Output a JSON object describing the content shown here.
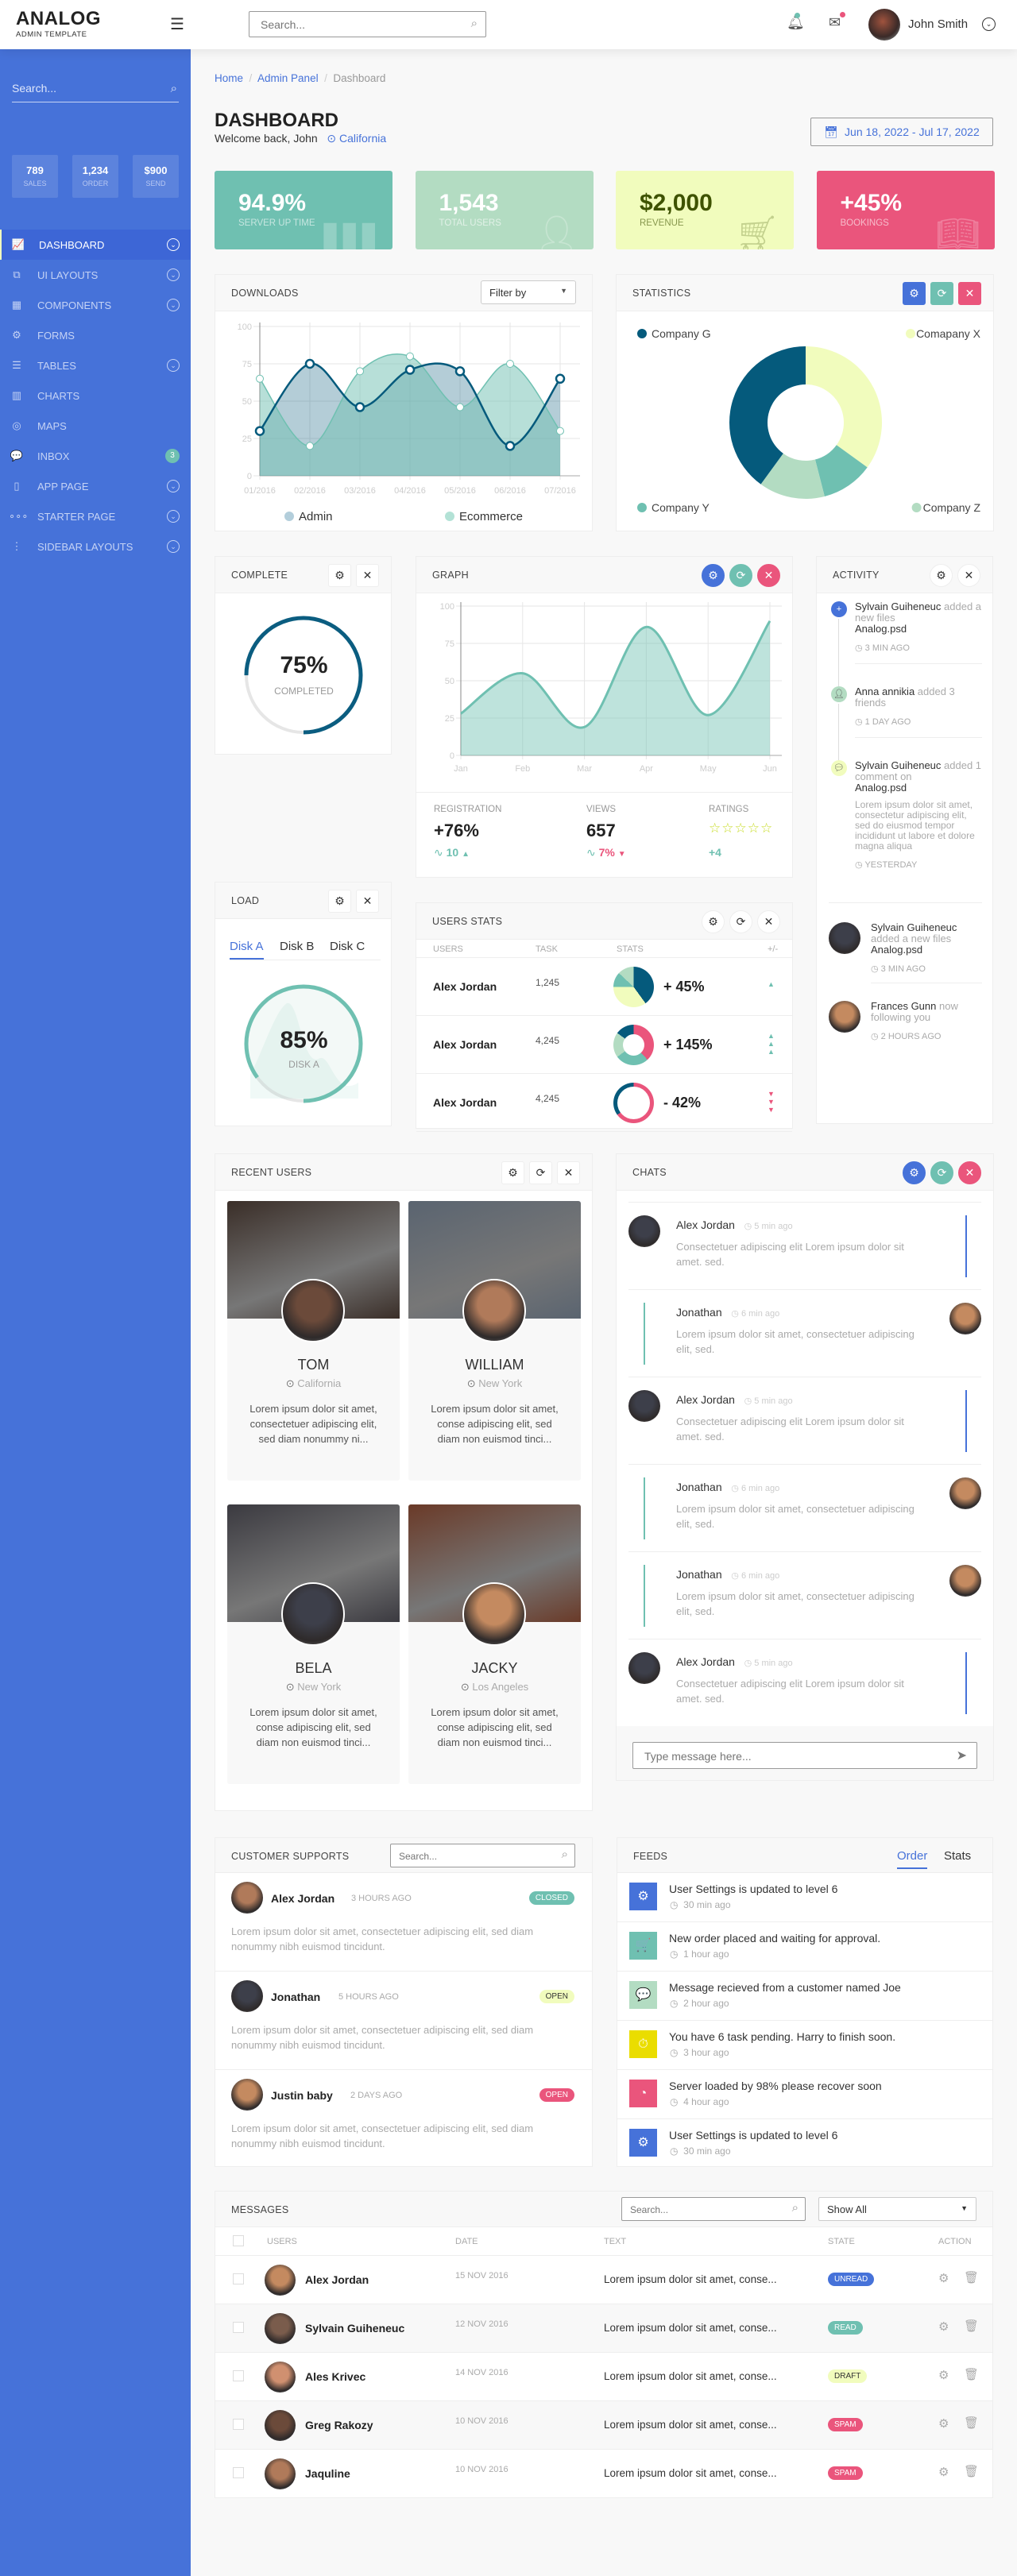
{
  "header": {
    "logo": "ANALOG",
    "logo_sub": "ADMIN TEMPLATE",
    "search_placeholder": "Search...",
    "user_name": "John Smith"
  },
  "sidebar": {
    "search_placeholder": "Search...",
    "stats": [
      {
        "value": "789",
        "label": "SALES"
      },
      {
        "value": "1,234",
        "label": "ORDER"
      },
      {
        "value": "$900",
        "label": "SEND"
      }
    ],
    "items": [
      {
        "label": "DASHBOARD",
        "icon": "chart-line-icon",
        "glyph": "📈",
        "active": true,
        "chevron": true
      },
      {
        "label": "UI LAYOUTS",
        "icon": "layers-icon",
        "glyph": "⧉",
        "chevron": true
      },
      {
        "label": "COMPONENTS",
        "icon": "grid-icon",
        "glyph": "▦",
        "chevron": true
      },
      {
        "label": "FORMS",
        "icon": "gear-icon",
        "glyph": "⚙",
        "chevron": false
      },
      {
        "label": "TABLES",
        "icon": "list-icon",
        "glyph": "☰",
        "chevron": true
      },
      {
        "label": "CHARTS",
        "icon": "bar-chart-icon",
        "glyph": "▥",
        "chevron": false
      },
      {
        "label": "MAPS",
        "icon": "map-pin-icon",
        "glyph": "◎",
        "chevron": false
      },
      {
        "label": "INBOX",
        "icon": "chat-icon",
        "glyph": "💬",
        "chevron": false,
        "badge": "3"
      },
      {
        "label": "APP PAGE",
        "icon": "book-icon",
        "glyph": "▯",
        "chevron": true
      },
      {
        "label": "STARTER PAGE",
        "icon": "dots-horizontal-icon",
        "glyph": "∘∘∘",
        "chevron": true
      },
      {
        "label": "SIDEBAR LAYOUTS",
        "icon": "dots-vertical-icon",
        "glyph": "⋮",
        "chevron": true
      }
    ]
  },
  "page": {
    "breadcrumb": [
      "Home",
      "Admin Panel",
      "Dashboard"
    ],
    "title": "DASHBOARD",
    "welcome": "Welcome back, John",
    "location": "California",
    "date_range": "Jun 18, 2022 - Jul 17, 2022"
  },
  "stat_cards": [
    {
      "value": "94.9%",
      "label": "SERVER UP TIME",
      "bg": "#6fc0b1",
      "fg": "#ffffff",
      "icon": "bar-chart-icon"
    },
    {
      "value": "1,543",
      "label": "TOTAL USERS",
      "bg": "#b3dcc2",
      "fg": "#ffffff",
      "icon": "user-icon"
    },
    {
      "value": "$2,000",
      "label": "REVENUE",
      "bg": "#f1fcbd",
      "fg": "#3e5200",
      "icon": "cart-icon"
    },
    {
      "value": "+45%",
      "label": "BOOKINGS",
      "bg": "#ea557c",
      "fg": "#ffffff",
      "icon": "book-icon"
    }
  ],
  "downloads": {
    "title": "DOWNLOADS",
    "filter": "Filter by"
  },
  "statistics": {
    "title": "STATISTICS"
  },
  "complete": {
    "title": "COMPLETE",
    "value": "75%",
    "label": "COMPLETED",
    "percent": 75
  },
  "graph": {
    "title": "GRAPH",
    "stats": [
      {
        "label": "REGISTRATION",
        "value": "+76%",
        "sub": "10",
        "trend": "up",
        "color": "#6fc0b1"
      },
      {
        "label": "VIEWS",
        "value": "657",
        "sub": "7%",
        "trend": "down",
        "color": "#ea557c"
      },
      {
        "label": "RATINGS",
        "value": "",
        "sub": "+4",
        "stars": 5,
        "color": "#6fc0b1"
      }
    ]
  },
  "activity": {
    "title": "ACTIVITY",
    "items": [
      {
        "name": "Sylvain Guiheneuc",
        "action": "added a new files",
        "file": "Analog.psd",
        "time": "3 MIN AGO",
        "icon": "plus-icon",
        "color": "#4672d9"
      },
      {
        "name": "Anna annikia",
        "action": "added 3 friends",
        "file": "",
        "time": "1 DAY AGO",
        "icon": "user-icon",
        "color": "#b3dcc2"
      },
      {
        "name": "Sylvain Guiheneuc",
        "action": "added 1 comment on",
        "file": "Analog.psd",
        "body": "Lorem ipsum dolor sit amet, consectetur adipiscing elit, sed do eiusmod tempor incididunt ut labore et dolore magna aliqua",
        "time": "YESTERDAY",
        "icon": "chat-icon",
        "color": "#f1fcbd"
      }
    ],
    "items2": [
      {
        "name": "Sylvain Guiheneuc",
        "action": "added a new files",
        "file": "Analog.psd",
        "time": "3 MIN AGO"
      },
      {
        "name": "Frances Gunn",
        "action": "now following you",
        "file": "",
        "time": "2 HOURS AGO"
      }
    ]
  },
  "load": {
    "title": "LOAD",
    "tabs": [
      "Disk A",
      "Disk B",
      "Disk C"
    ],
    "active_tab": 0,
    "value": "85%",
    "label": "DISK A",
    "percent": 85
  },
  "users_stats": {
    "title": "USERS STATS",
    "columns": [
      "USERS",
      "TASK",
      "STATS",
      "+/-"
    ],
    "rows": [
      {
        "name": "Alex Jordan",
        "task": "1,245",
        "change": "+ 45%",
        "trend": "up",
        "arrows": 1
      },
      {
        "name": "Alex Jordan",
        "task": "4,245",
        "change": "+ 145%",
        "trend": "up",
        "arrows": 3
      },
      {
        "name": "Alex Jordan",
        "task": "4,245",
        "change": "- 42%",
        "trend": "down",
        "arrows": 3
      }
    ]
  },
  "recent_users": {
    "title": "RECENT USERS",
    "users": [
      {
        "name": "TOM",
        "location": "California",
        "text": "Lorem ipsum dolor sit amet, consectetuer adipiscing elit, sed diam nonummy ni..."
      },
      {
        "name": "WILLIAM",
        "location": "New York",
        "text": "Lorem ipsum dolor sit amet, conse adipiscing elit, sed diam non euismod tinci..."
      },
      {
        "name": "BELA",
        "location": "New York",
        "text": "Lorem ipsum dolor sit amet, conse adipiscing elit, sed diam non euismod tinci..."
      },
      {
        "name": "JACKY",
        "location": "Los Angeles",
        "text": "Lorem ipsum dolor sit amet, conse adipiscing elit, sed diam non euismod tinci..."
      }
    ]
  },
  "chats": {
    "title": "CHATS",
    "input_placeholder": "Type message here...",
    "messages": [
      {
        "name": "Alex Jordan",
        "time": "5 min ago",
        "text": "Consectetuer adipiscing elit Lorem ipsum dolor sit amet. sed.",
        "side": "left"
      },
      {
        "name": "Jonathan",
        "time": "6 min ago",
        "text": "Lorem ipsum dolor sit amet, consectetuer adipiscing elit, sed.",
        "side": "right"
      },
      {
        "name": "Alex Jordan",
        "time": "5 min ago",
        "text": "Consectetuer adipiscing elit Lorem ipsum dolor sit amet. sed.",
        "side": "left"
      },
      {
        "name": "Jonathan",
        "time": "6 min ago",
        "text": "Lorem ipsum dolor sit amet, consectetuer adipiscing elit, sed.",
        "side": "right"
      },
      {
        "name": "Jonathan",
        "time": "6 min ago",
        "text": "Lorem ipsum dolor sit amet, consectetuer adipiscing elit, sed.",
        "side": "right"
      },
      {
        "name": "Alex Jordan",
        "time": "5 min ago",
        "text": "Consectetuer adipiscing elit Lorem ipsum dolor sit amet. sed.",
        "side": "left"
      }
    ]
  },
  "supports": {
    "title": "CUSTOMER SUPPORTS",
    "search_placeholder": "Search...",
    "items": [
      {
        "name": "Alex Jordan",
        "time": "3 HOURS AGO",
        "status": "CLOSED",
        "status_bg": "#6fc0b1",
        "status_fg": "#ffffff",
        "text": "Lorem ipsum dolor sit amet, consectetuer adipiscing elit, sed diam nonummy nibh euismod tincidunt."
      },
      {
        "name": "Jonathan",
        "time": "5 HOURS AGO",
        "status": "OPEN",
        "status_bg": "#f1fcbd",
        "status_fg": "#333333",
        "text": "Lorem ipsum dolor sit amet, consectetuer adipiscing elit, sed diam nonummy nibh euismod tincidunt."
      },
      {
        "name": "Justin baby",
        "time": "2 DAYS AGO",
        "status": "OPEN",
        "status_bg": "#ea557c",
        "status_fg": "#ffffff",
        "text": "Lorem ipsum dolor sit amet, consectetuer adipiscing elit, sed diam nonummy nibh euismod tincidunt."
      }
    ]
  },
  "feeds": {
    "title": "FEEDS",
    "tabs": [
      "Order",
      "Stats"
    ],
    "active_tab": 0,
    "items": [
      {
        "text": "User Settings is updated to level 6",
        "time": "30 min ago",
        "icon": "gear-icon",
        "glyph": "⚙",
        "color": "#4672d9"
      },
      {
        "text": "New order placed and waiting for approval.",
        "time": "1 hour ago",
        "icon": "cart-icon",
        "glyph": "🛒",
        "color": "#6fc0b1"
      },
      {
        "text": "Message recieved from a customer named Joe",
        "time": "2 hour ago",
        "icon": "chat-icon",
        "glyph": "💬",
        "color": "#b3dcc2"
      },
      {
        "text": "You have 6 task pending. Harry to finish soon.",
        "time": "3 hour ago",
        "icon": "timer-icon",
        "glyph": "⏱",
        "color": "#eadd00"
      },
      {
        "text": "Server loaded by 98% please recover soon",
        "time": "4 hour ago",
        "icon": "gauge-icon",
        "glyph": "◔",
        "color": "#ea557c"
      },
      {
        "text": "User Settings is updated to level 6",
        "time": "30 min ago",
        "icon": "gear-icon",
        "glyph": "⚙",
        "color": "#4672d9"
      }
    ]
  },
  "messages": {
    "title": "MESSAGES",
    "search_placeholder": "Search...",
    "filter": "Show All",
    "columns": [
      "USERS",
      "DATE",
      "TEXT",
      "STATE",
      "ACTION"
    ],
    "rows": [
      {
        "name": "Alex Jordan",
        "date": "15 NOV 2016",
        "text": "Lorem ipsum dolor sit amet, conse...",
        "state": "UNREAD",
        "state_bg": "#4672d9",
        "state_fg": "#ffffff"
      },
      {
        "name": "Sylvain Guiheneuc",
        "date": "12 NOV 2016",
        "text": "Lorem ipsum dolor sit amet, conse...",
        "state": "READ",
        "state_bg": "#6fc0b1",
        "state_fg": "#ffffff"
      },
      {
        "name": "Ales Krivec",
        "date": "14 NOV 2016",
        "text": "Lorem ipsum dolor sit amet, conse...",
        "state": "DRAFT",
        "state_bg": "#f1fcbd",
        "state_fg": "#333333"
      },
      {
        "name": "Greg Rakozy",
        "date": "10 NOV 2016",
        "text": "Lorem ipsum dolor sit amet, conse...",
        "state": "SPAM",
        "state_bg": "#ea557c",
        "state_fg": "#ffffff"
      },
      {
        "name": "Jaquline",
        "date": "10 NOV 2016",
        "text": "Lorem ipsum dolor sit amet, conse...",
        "state": "SPAM",
        "state_bg": "#ea557c",
        "state_fg": "#ffffff"
      }
    ]
  },
  "colors": {
    "primary": "#4672d9",
    "teal": "#6fc0b1",
    "mint": "#b3dcc2",
    "lime": "#f1fcbd",
    "pink": "#ea557c",
    "navy": "#055a7c"
  },
  "chart_data": [
    {
      "type": "area",
      "title": "",
      "x": [
        "01/2016",
        "02/2016",
        "03/2016",
        "04/2016",
        "05/2016",
        "06/2016",
        "07/2016"
      ],
      "ylim": [
        0,
        100
      ],
      "yticks": [
        0,
        25,
        50,
        75,
        100
      ],
      "grid": true,
      "legend": "bottom",
      "series": [
        {
          "name": "Admin",
          "values": [
            30,
            75,
            46,
            71,
            70,
            20,
            65
          ],
          "color": "#055a7c"
        },
        {
          "name": "Ecommerce",
          "values": [
            65,
            20,
            70,
            80,
            46,
            75,
            30
          ],
          "color": "#6fc0b1"
        }
      ]
    },
    {
      "type": "pie",
      "title": "",
      "donut": true,
      "legend": "corners",
      "slices": [
        {
          "name": "Comapany X",
          "value": 35,
          "color": "#f1fcbd"
        },
        {
          "name": "Company Y",
          "value": 11,
          "color": "#6fc0b1"
        },
        {
          "name": "Company Z",
          "value": 14,
          "color": "#b3dcc2"
        },
        {
          "name": "Company G",
          "value": 40,
          "color": "#055a7c"
        }
      ]
    },
    {
      "type": "area",
      "title": "",
      "x": [
        "Jan",
        "Feb",
        "Mar",
        "Apr",
        "May",
        "Jun"
      ],
      "ylim": [
        0,
        100
      ],
      "yticks": [
        0,
        25,
        50,
        75,
        100
      ],
      "grid": true,
      "series": [
        {
          "values": [
            28,
            55,
            19,
            86,
            27,
            90
          ],
          "color": "#6fc0b1"
        }
      ]
    }
  ]
}
